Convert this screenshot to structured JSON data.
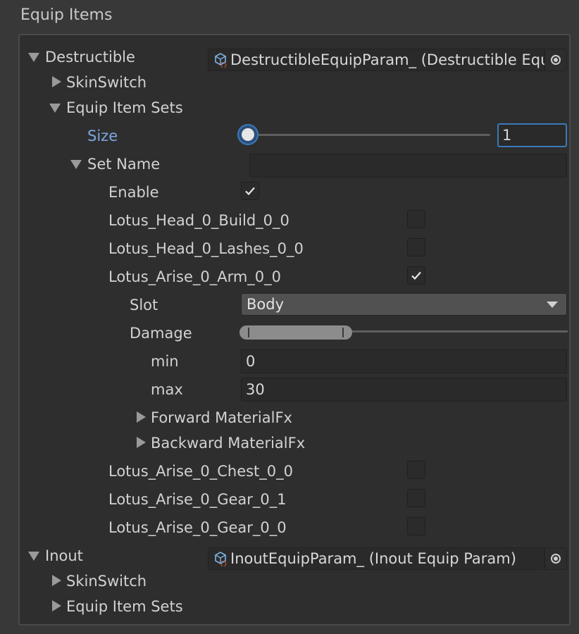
{
  "section_title": "Equip Items",
  "destructible": {
    "label": "Destructible",
    "object_ref": "DestructibleEquipParam_ (Destructible Equip Param)",
    "skin_switch_label": "SkinSwitch",
    "equip_item_sets_label": "Equip Item Sets",
    "size": {
      "label": "Size",
      "value": "1",
      "slider_fraction": 0.0
    },
    "set_name": {
      "label": "Set Name",
      "value": ""
    },
    "enable": {
      "label": "Enable",
      "checked": true
    },
    "items": [
      {
        "label": "Lotus_Head_0_Build_0_0",
        "checked": false
      },
      {
        "label": "Lotus_Head_0_Lashes_0_0",
        "checked": false
      },
      {
        "label": "Lotus_Arise_0_Arm_0_0",
        "checked": true
      },
      {
        "label": "Lotus_Arise_0_Chest_0_0",
        "checked": false
      },
      {
        "label": "Lotus_Arise_0_Gear_0_1",
        "checked": false
      },
      {
        "label": "Lotus_Arise_0_Gear_0_0",
        "checked": false
      }
    ],
    "arm_item": {
      "slot": {
        "label": "Slot",
        "value": "Body"
      },
      "damage": {
        "label": "Damage",
        "min_label": "min",
        "min_value": "0",
        "max_label": "max",
        "max_value": "30",
        "range_fraction_start": 0.0,
        "range_fraction_end": 0.33
      },
      "forward_materialfx_label": "Forward MaterialFx",
      "backward_materialfx_label": "Backward MaterialFx"
    }
  },
  "inout": {
    "label": "Inout",
    "object_ref": "InoutEquipParam_ (Inout Equip Param)",
    "skin_switch_label": "SkinSwitch",
    "equip_item_sets_label": "Equip Item Sets"
  },
  "colors": {
    "accent_blue": "#3a79bb",
    "highlight_label": "#7ea6e0",
    "panel_bg": "#2e2e2e",
    "window_bg": "#383838"
  },
  "icons": {
    "expanded": "triangle-down-icon",
    "collapsed": "triangle-right-icon",
    "object": "scriptable-object-icon",
    "picker": "object-picker-icon",
    "check": "checkmark-icon"
  }
}
